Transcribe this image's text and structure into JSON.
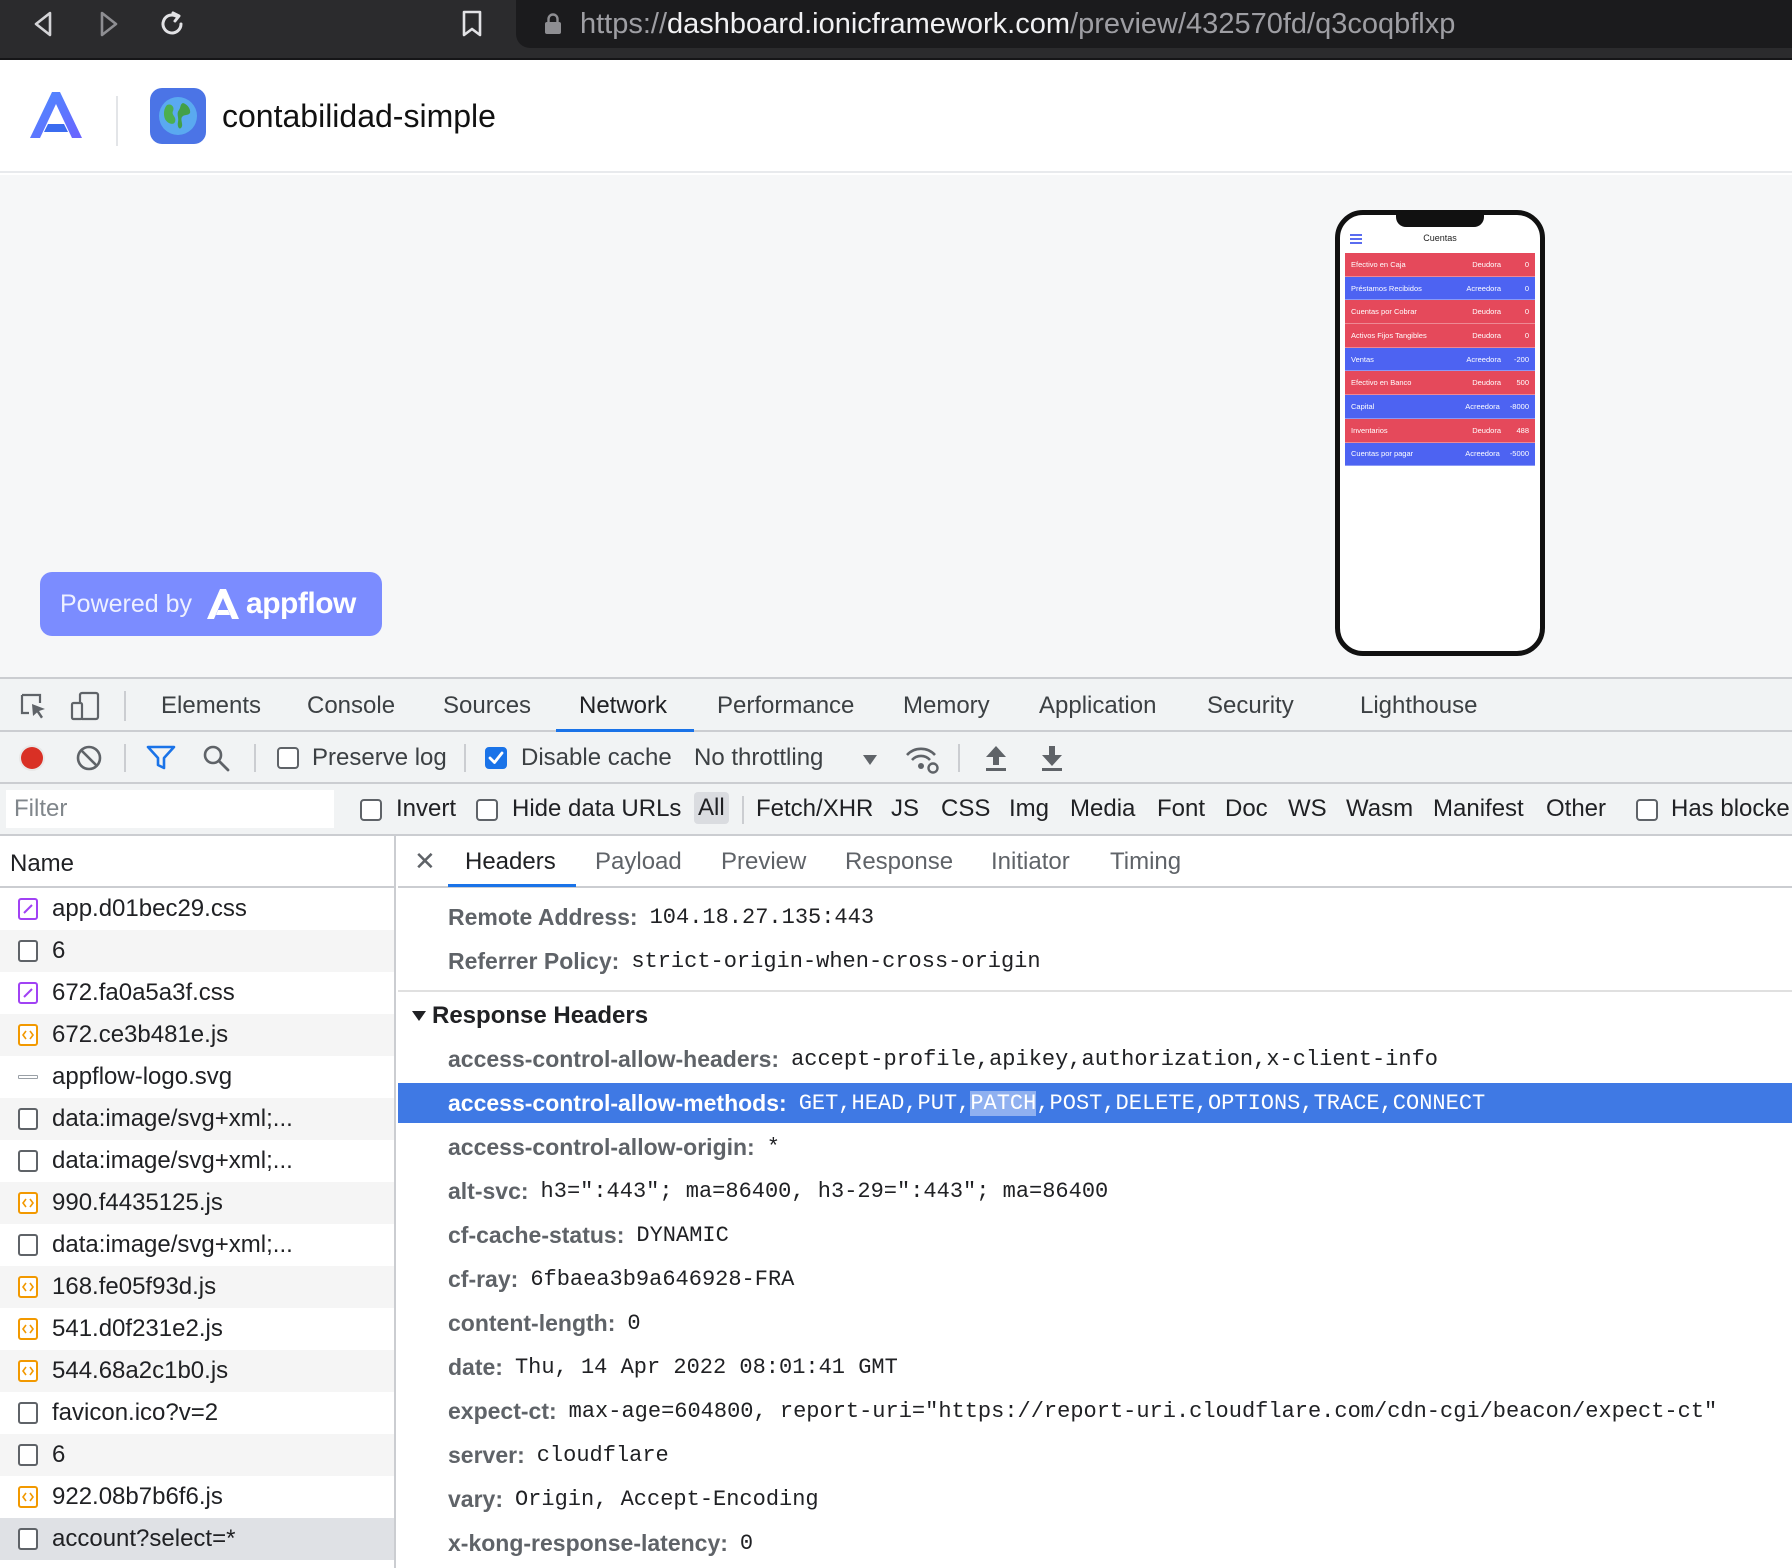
{
  "browser": {
    "url_scheme": "https://",
    "url_host": "dashboard.ionicframework.com",
    "url_path": "/preview/432570fd/q3coqbflxp"
  },
  "app": {
    "name": "contabilidad-simple",
    "powered_by": "Powered by",
    "brand_word": "appflow"
  },
  "phone": {
    "title": "Cuentas",
    "rows": [
      {
        "name": "Efectivo en Caja",
        "type": "Deudora",
        "value": "0",
        "color": "#e5495b"
      },
      {
        "name": "Préstamos Recibidos",
        "type": "Acreedora",
        "value": "0",
        "color": "#4d63f2"
      },
      {
        "name": "Cuentas por Cobrar",
        "type": "Deudora",
        "value": "0",
        "color": "#e5495b"
      },
      {
        "name": "Activos Fijos Tangibles",
        "type": "Deudora",
        "value": "0",
        "color": "#e5495b"
      },
      {
        "name": "Ventas",
        "type": "Acreedora",
        "value": "-200",
        "color": "#4d63f2"
      },
      {
        "name": "Efectivo en Banco",
        "type": "Deudora",
        "value": "500",
        "color": "#e5495b"
      },
      {
        "name": "Capital",
        "type": "Acreedora",
        "value": "-8000",
        "color": "#4d63f2"
      },
      {
        "name": "Inventarios",
        "type": "Deudora",
        "value": "488",
        "color": "#e5495b"
      },
      {
        "name": "Cuentas por pagar",
        "type": "Acreedora",
        "value": "-5000",
        "color": "#4d63f2"
      }
    ]
  },
  "devtools": {
    "tabs": {
      "elements": "Elements",
      "console": "Console",
      "sources": "Sources",
      "network": "Network",
      "performance": "Performance",
      "memory": "Memory",
      "application": "Application",
      "security": "Security",
      "lighthouse": "Lighthouse"
    },
    "toolbar": {
      "preserve_log": "Preserve log",
      "disable_cache": "Disable cache",
      "throttling": "No throttling"
    },
    "filter": {
      "placeholder": "Filter",
      "invert": "Invert",
      "hide_data_urls": "Hide data URLs",
      "types": [
        "All",
        "Fetch/XHR",
        "JS",
        "CSS",
        "Img",
        "Media",
        "Font",
        "Doc",
        "WS",
        "Wasm",
        "Manifest",
        "Other"
      ],
      "has_blocked": "Has blocke"
    },
    "name_header": "Name",
    "requests": [
      {
        "name": "app.d01bec29.css",
        "kind": "css"
      },
      {
        "name": "6",
        "kind": "doc"
      },
      {
        "name": "672.fa0a5a3f.css",
        "kind": "css"
      },
      {
        "name": "672.ce3b481e.js",
        "kind": "js"
      },
      {
        "name": "appflow-logo.svg",
        "kind": "img"
      },
      {
        "name": "data:image/svg+xml;...",
        "kind": "doc"
      },
      {
        "name": "data:image/svg+xml;...",
        "kind": "doc"
      },
      {
        "name": "990.f4435125.js",
        "kind": "js"
      },
      {
        "name": "data:image/svg+xml;...",
        "kind": "doc"
      },
      {
        "name": "168.fe05f93d.js",
        "kind": "js"
      },
      {
        "name": "541.d0f231e2.js",
        "kind": "js"
      },
      {
        "name": "544.68a2c1b0.js",
        "kind": "js"
      },
      {
        "name": "favicon.ico?v=2",
        "kind": "doc"
      },
      {
        "name": "6",
        "kind": "doc"
      },
      {
        "name": "922.08b7b6f6.js",
        "kind": "js"
      },
      {
        "name": "account?select=*",
        "kind": "doc"
      }
    ],
    "detail_tabs": {
      "headers": "Headers",
      "payload": "Payload",
      "preview": "Preview",
      "response": "Response",
      "initiator": "Initiator",
      "timing": "Timing"
    },
    "general": [
      {
        "key": "Remote Address:",
        "value": "104.18.27.135:443"
      },
      {
        "key": "Referrer Policy:",
        "value": "strict-origin-when-cross-origin"
      }
    ],
    "response_headers_title": "Response Headers",
    "response_headers": [
      {
        "key": "access-control-allow-headers:",
        "value": "accept-profile,apikey,authorization,x-client-info"
      },
      {
        "key": "access-control-allow-methods:",
        "value_pre": "GET,HEAD,PUT,",
        "value_sel": "PATCH",
        "value_post": ",POST,DELETE,OPTIONS,TRACE,CONNECT"
      },
      {
        "key": "access-control-allow-origin:",
        "value": "*"
      },
      {
        "key": "alt-svc:",
        "value": "h3=\":443\"; ma=86400, h3-29=\":443\"; ma=86400"
      },
      {
        "key": "cf-cache-status:",
        "value": "DYNAMIC"
      },
      {
        "key": "cf-ray:",
        "value": "6fbaea3b9a646928-FRA"
      },
      {
        "key": "content-length:",
        "value": "0"
      },
      {
        "key": "date:",
        "value": "Thu, 14 Apr 2022 08:01:41 GMT"
      },
      {
        "key": "expect-ct:",
        "value": "max-age=604800, report-uri=\"https://report-uri.cloudflare.com/cdn-cgi/beacon/expect-ct\""
      },
      {
        "key": "server:",
        "value": "cloudflare"
      },
      {
        "key": "vary:",
        "value": "Origin, Accept-Encoding"
      },
      {
        "key": "x-kong-response-latency:",
        "value": "0"
      }
    ]
  }
}
